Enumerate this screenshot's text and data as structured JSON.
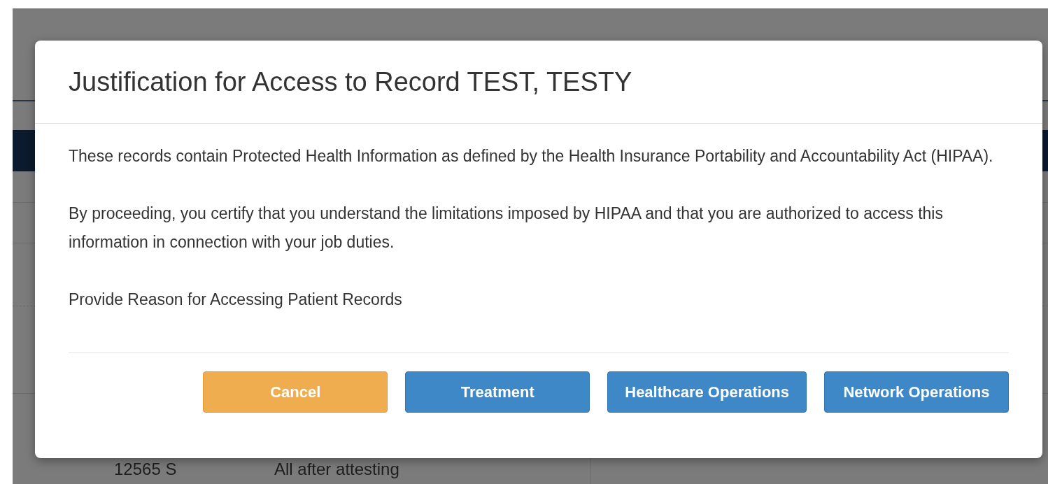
{
  "background": {
    "rows": [
      {
        "cells": [
          "12565 S",
          "All after attesting"
        ]
      }
    ]
  },
  "dialog": {
    "title": "Justification for Access to Record TEST, TESTY",
    "paragraphs": [
      "These records contain Protected Health Information as defined by the Health Insurance Portability and Accountability Act (HIPAA).",
      "By proceeding, you certify that you understand the limitations imposed by HIPAA and that you are authorized to access this information in connection with your job duties.",
      "Provide Reason for Accessing Patient Records"
    ],
    "buttons": [
      {
        "label": "Cancel",
        "kind": "cancel"
      },
      {
        "label": "Treatment",
        "kind": "primary"
      },
      {
        "label": "Healthcare Operations",
        "kind": "primary"
      },
      {
        "label": "Network Operations",
        "kind": "primary"
      }
    ]
  }
}
